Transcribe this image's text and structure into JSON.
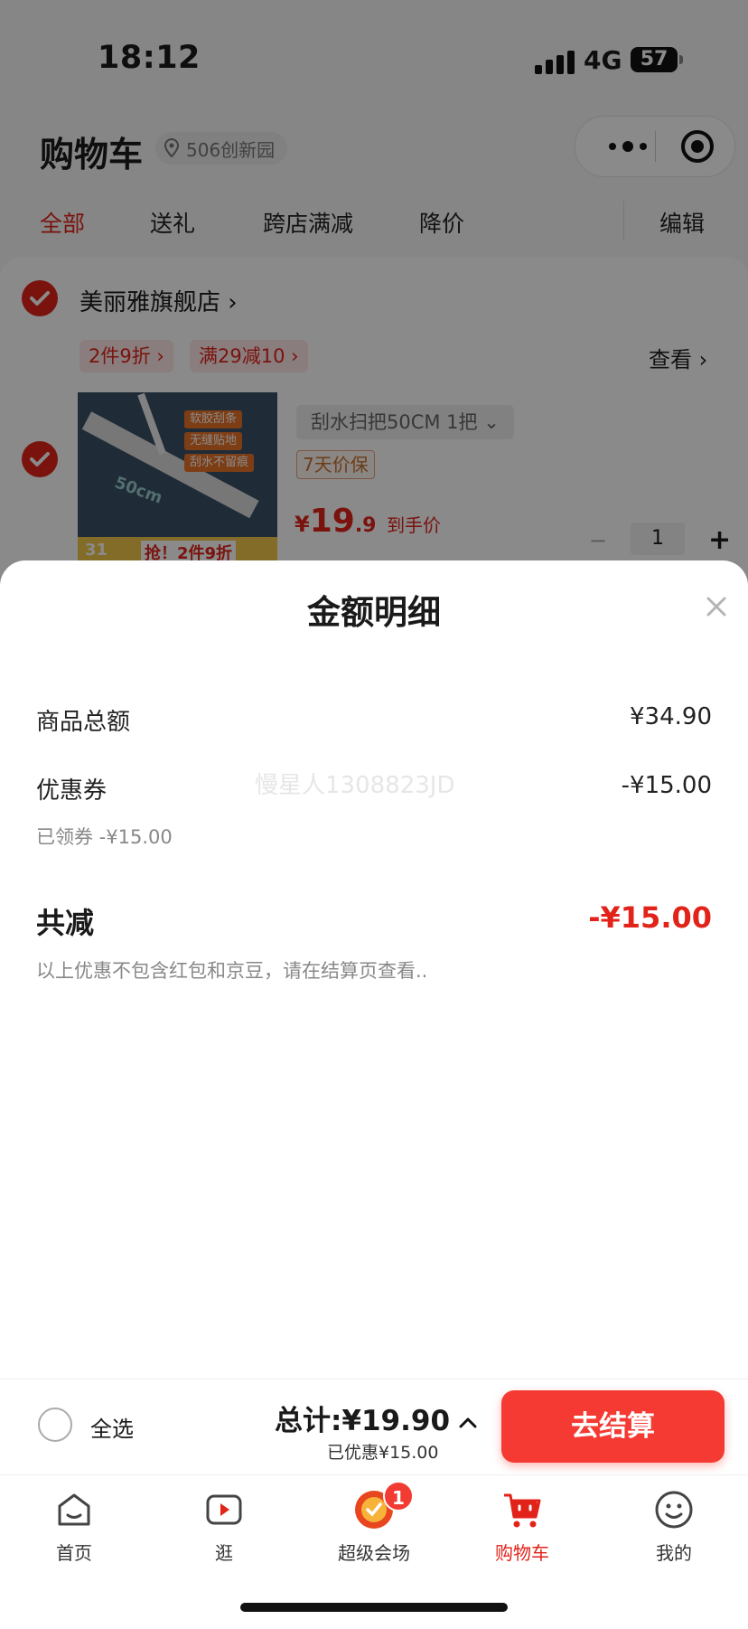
{
  "status_bar": {
    "time": "18:12",
    "network": "4G",
    "battery": "57"
  },
  "header": {
    "title": "购物车",
    "location": "506创新园"
  },
  "tabs": [
    {
      "label": "全部",
      "active": true
    },
    {
      "label": "送礼",
      "active": false
    },
    {
      "label": "跨店满减",
      "active": false
    },
    {
      "label": "降价",
      "active": false
    }
  ],
  "edit_label": "编辑",
  "shop": {
    "name": "美丽雅旗舰店",
    "promos": [
      "2件9折",
      "满29减10"
    ],
    "view_more": "查看"
  },
  "product": {
    "spec": "刮水扫把50CM 1把",
    "guarantee": "7天价保",
    "price_symbol": "¥",
    "price_int": "19",
    "price_dec": ".9",
    "price_note": "到手价",
    "quantity": "1",
    "image_texts": [
      "软胶刮条",
      "无缝贴地",
      "刮水不留痕",
      "50cm",
      "抢！2件9折",
      "31"
    ]
  },
  "sheet": {
    "title": "金额明细",
    "subtotal_label": "商品总额",
    "subtotal_value": "¥34.90",
    "coupon_label": "优惠券",
    "coupon_value": "-¥15.00",
    "coupon_note": "已领券 -¥15.00",
    "watermark": "慢星人1308823JD",
    "total_label": "共减",
    "total_value": "-¥15.00",
    "disclaimer": "以上优惠不包含红包和京豆，请在结算页查看.."
  },
  "checkout": {
    "select_all": "全选",
    "total": "总计:¥19.90",
    "saved": "已优惠¥15.00",
    "pay_button": "去结算"
  },
  "tabbar": [
    {
      "label": "首页",
      "icon": "home-icon"
    },
    {
      "label": "逛",
      "icon": "video-icon"
    },
    {
      "label": "超级会场",
      "icon": "super-venue-icon",
      "badge": "1"
    },
    {
      "label": "购物车",
      "icon": "cart-icon",
      "active": true
    },
    {
      "label": "我的",
      "icon": "profile-icon"
    }
  ],
  "colors": {
    "accent": "#e2231a",
    "pay_button": "#f43a32",
    "promo_bg": "#fde8e8"
  }
}
